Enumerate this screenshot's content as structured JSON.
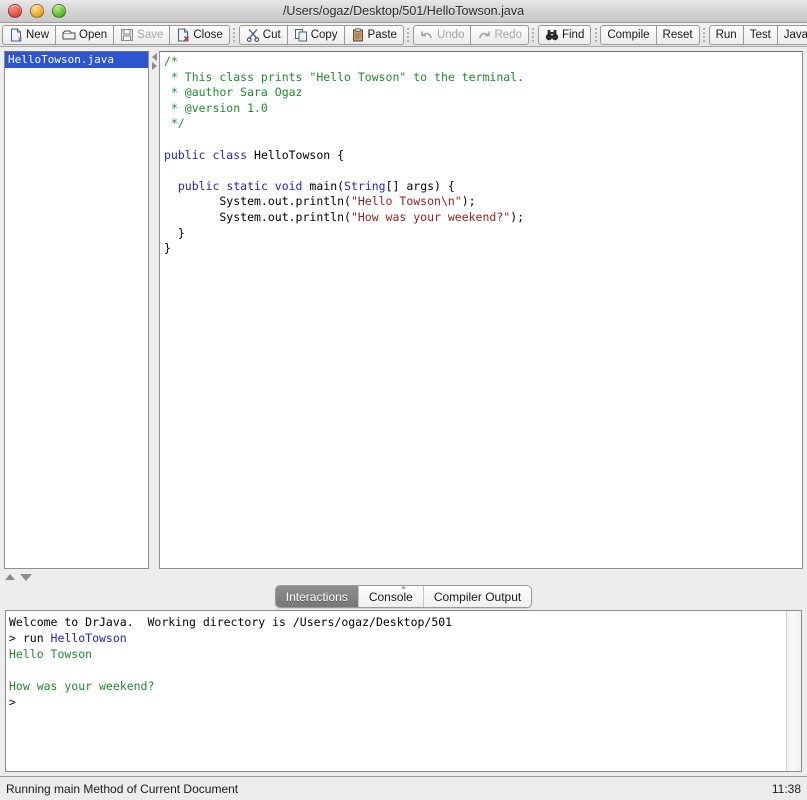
{
  "window": {
    "title": "/Users/ogaz/Desktop/501/HelloTowson.java",
    "close_label": "",
    "minimize_label": "",
    "zoom_label": ""
  },
  "toolbar": {
    "groups": [
      {
        "buttons": [
          {
            "label": "New",
            "icon": "new-file-icon",
            "enabled": true
          },
          {
            "label": "Open",
            "icon": "open-folder-icon",
            "enabled": true
          },
          {
            "label": "Save",
            "icon": "save-disk-icon",
            "enabled": false
          },
          {
            "label": "Close",
            "icon": "close-file-icon",
            "enabled": true
          }
        ]
      },
      {
        "buttons": [
          {
            "label": "Cut",
            "icon": "scissors-icon",
            "enabled": true
          },
          {
            "label": "Copy",
            "icon": "copy-icon",
            "enabled": true
          },
          {
            "label": "Paste",
            "icon": "clipboard-icon",
            "enabled": true
          }
        ]
      },
      {
        "buttons": [
          {
            "label": "Undo",
            "icon": "undo-arrow-icon",
            "enabled": false
          },
          {
            "label": "Redo",
            "icon": "redo-arrow-icon",
            "enabled": false
          }
        ]
      },
      {
        "buttons": [
          {
            "label": "Find",
            "icon": "binoculars-icon",
            "enabled": true
          }
        ]
      },
      {
        "buttons": [
          {
            "label": "Compile",
            "icon": "",
            "enabled": true
          },
          {
            "label": "Reset",
            "icon": "",
            "enabled": true
          }
        ]
      },
      {
        "buttons": [
          {
            "label": "Run",
            "icon": "",
            "enabled": true
          },
          {
            "label": "Test",
            "icon": "",
            "enabled": true
          },
          {
            "label": "Javadoc",
            "icon": "",
            "enabled": true
          }
        ]
      }
    ]
  },
  "file_panel": {
    "items": [
      {
        "name": "HelloTowson.java",
        "selected": true
      }
    ]
  },
  "editor": {
    "lines": [
      {
        "segments": [
          {
            "t": "/*",
            "c": "cmt"
          }
        ]
      },
      {
        "segments": [
          {
            "t": " * This class prints \"Hello Towson\" to the terminal.",
            "c": "cmt"
          }
        ]
      },
      {
        "segments": [
          {
            "t": " * @author Sara Ogaz",
            "c": "cmt"
          }
        ]
      },
      {
        "segments": [
          {
            "t": " * @version 1.0",
            "c": "cmt"
          }
        ]
      },
      {
        "segments": [
          {
            "t": " */",
            "c": "cmt"
          }
        ]
      },
      {
        "segments": [
          {
            "t": "",
            "c": ""
          }
        ]
      },
      {
        "segments": [
          {
            "t": "public class ",
            "c": "kw"
          },
          {
            "t": "HelloTowson {",
            "c": ""
          }
        ]
      },
      {
        "segments": [
          {
            "t": "",
            "c": ""
          }
        ]
      },
      {
        "segments": [
          {
            "t": "  ",
            "c": ""
          },
          {
            "t": "public static void ",
            "c": "kw"
          },
          {
            "t": "main(",
            "c": ""
          },
          {
            "t": "String",
            "c": "typ"
          },
          {
            "t": "[] args) {",
            "c": ""
          }
        ]
      },
      {
        "segments": [
          {
            "t": "        System.out.println(",
            "c": ""
          },
          {
            "t": "\"Hello Towson\\n\"",
            "c": "str"
          },
          {
            "t": ");",
            "c": ""
          }
        ]
      },
      {
        "segments": [
          {
            "t": "        System.out.println(",
            "c": ""
          },
          {
            "t": "\"How was your weekend?\"",
            "c": "str"
          },
          {
            "t": ");",
            "c": ""
          }
        ]
      },
      {
        "segments": [
          {
            "t": "  }",
            "c": ""
          }
        ]
      },
      {
        "segments": [
          {
            "t": "}",
            "c": ""
          }
        ]
      }
    ]
  },
  "bottom_tabs": {
    "items": [
      {
        "label": "Interactions",
        "active": true
      },
      {
        "label": "Console",
        "active": false
      },
      {
        "label": "Compiler Output",
        "active": false
      }
    ]
  },
  "interactions": {
    "lines": [
      {
        "segments": [
          {
            "t": "Welcome to DrJava.  Working directory is /Users/ogaz/Desktop/501",
            "c": ""
          }
        ]
      },
      {
        "segments": [
          {
            "t": "> run ",
            "c": ""
          },
          {
            "t": "HelloTowson",
            "c": "id"
          }
        ]
      },
      {
        "segments": [
          {
            "t": "Hello Towson",
            "c": "out"
          }
        ]
      },
      {
        "segments": [
          {
            "t": "",
            "c": ""
          }
        ]
      },
      {
        "segments": [
          {
            "t": "How was your weekend?",
            "c": "out"
          }
        ]
      },
      {
        "segments": [
          {
            "t": ">",
            "c": ""
          }
        ]
      }
    ]
  },
  "statusbar": {
    "message": "Running main Method of Current Document",
    "time": "11:38"
  },
  "colors": {
    "keyword": "#2424c8",
    "comment": "#1f8b2e",
    "string": "#9c1a1a",
    "output": "#1f8b2e",
    "selection": "#2b56d0"
  }
}
